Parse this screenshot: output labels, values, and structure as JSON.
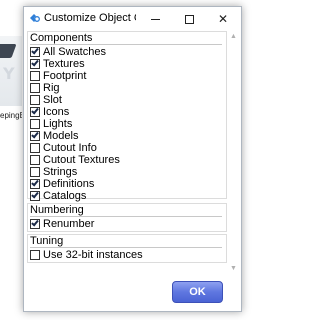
{
  "background": {
    "caption": "epingB"
  },
  "window": {
    "title": "Customize Object Cl...",
    "min_glyph": "",
    "close_glyph": "✕",
    "icon": "puzzle-gear-icon",
    "accent": "#2f7fd8"
  },
  "components": {
    "header": "Components",
    "items": [
      {
        "label": "All Swatches",
        "checked": true
      },
      {
        "label": "Textures",
        "checked": true
      },
      {
        "label": "Footprint",
        "checked": false
      },
      {
        "label": "Rig",
        "checked": false
      },
      {
        "label": "Slot",
        "checked": false
      },
      {
        "label": "Icons",
        "checked": true
      },
      {
        "label": "Lights",
        "checked": false
      },
      {
        "label": "Models",
        "checked": true
      },
      {
        "label": "Cutout Info",
        "checked": false
      },
      {
        "label": "Cutout Textures",
        "checked": false
      },
      {
        "label": "Strings",
        "checked": false
      },
      {
        "label": "Definitions",
        "checked": true
      },
      {
        "label": "Catalogs",
        "checked": true
      }
    ]
  },
  "numbering": {
    "header": "Numbering",
    "items": [
      {
        "label": "Renumber",
        "checked": true
      }
    ]
  },
  "tuning": {
    "header": "Tuning",
    "items": [
      {
        "label": "Use 32-bit instances",
        "checked": false
      }
    ]
  },
  "ok_label": "OK",
  "colors": {
    "ok_button": "#5f77e0",
    "check_mark": "#1b2a48"
  }
}
